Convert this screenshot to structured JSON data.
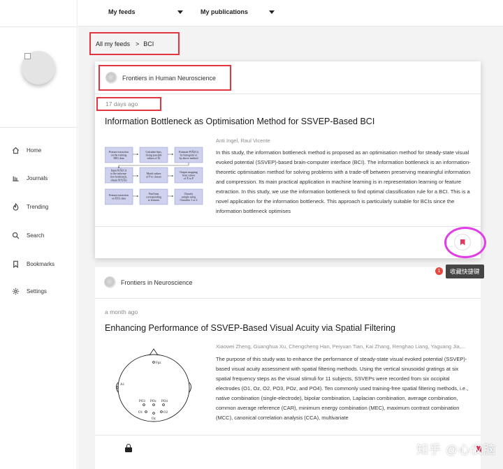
{
  "topbar": {
    "my_feeds": "My feeds",
    "my_publications": "My publications"
  },
  "breadcrumb": {
    "root": "All my feeds",
    "separator": ">",
    "current": "BCI"
  },
  "sidebar": {
    "items": [
      {
        "label": "Home",
        "icon": "home-icon"
      },
      {
        "label": "Journals",
        "icon": "journals-icon"
      },
      {
        "label": "Trending",
        "icon": "flame-icon"
      },
      {
        "label": "Search",
        "icon": "search-icon"
      },
      {
        "label": "Bookmarks",
        "icon": "bookmark-icon"
      },
      {
        "label": "Settings",
        "icon": "gear-icon"
      }
    ]
  },
  "articles": [
    {
      "source": "Frontiers in Human Neuroscience",
      "time": "17 days ago",
      "title": "Information Bottleneck as Optimisation Method for SSVEP-Based BCI",
      "authors": "Anti Ingel, Raul Vicente",
      "abstract": "In this study, the information bottleneck method is proposed as an optimisation method for steady-state visual evoked potential (SSVEP)-based brain-computer interface (BCI). The information bottleneck is an information-theoretic optimisation method for solving problems with a trade-off between preserving meaningful information and compression. Its main practical application in machine learning is in representation learning or feature extraction. In this study, we use the information bottleneck to find optimal classification rule for a BCI. This is a novel application for the information bottleneck. This approach is particularly suitable for BCIs since the information bottleneck optimises",
      "figure": {
        "boxes": [
          [
            "Feature extraction",
            "on the training",
            "EEG data"
          ],
          [
            "Calculate bins,",
            "fixing possible",
            "values of X̂i"
          ],
          [
            "Estimate P(X̂i|Ci)",
            "by histogram or",
            "by above method"
          ],
          [
            "Input P(X̂i|Ci)",
            "to the informa-",
            "tion bottleneck,",
            "obtain P(Y|X̂i)"
          ],
          [
            "Match values",
            "of P to classes"
          ],
          [
            "Output mapping",
            "from values",
            "of X̂ to P"
          ],
          [
            "Feature extraction",
            "on EEG data"
          ],
          [
            "Find bins",
            "corresponding",
            "to features"
          ],
          [
            "Classify",
            "sample using",
            "Classifier 1 or 2"
          ]
        ]
      }
    },
    {
      "source": "Frontiers in Neuroscience",
      "time": "a month ago",
      "title": "Enhancing Performance of SSVEP-Based Visual Acuity via Spatial Filtering",
      "authors": "Xiaowei Zheng, Guanghua Xu, Chengcheng Han, Peiyuan Tian, Kai Zhang, Renghao Liang, Yaguang Jia,...",
      "abstract": "The purpose of this study was to enhance the performance of steady-state visual evoked potential (SSVEP)-based visual acuity assessment with spatial filtering methods. Using the vertical sinusoidal gratings at six spatial frequency steps as the visual stimuli for 11 subjects, SSVEPs were recorded from six occipital electrodes (O1, Oz, O2, PO3, POz, and PO4). Ten commonly used training-free spatial filtering methods, i.e., native combination (single-electrode), bipolar combination, Laplacian combination, average combination, common average reference (CAR), minimum energy combination (MEC), maximum contrast combination (MCC), canonical correlation analysis (CCA), multivariate",
      "figure": {
        "labels": {
          "fpz": "Fpz",
          "a1": "A1",
          "po3": "PO3",
          "poz": "POz",
          "po4": "PO4",
          "o1": "O1",
          "oz": "Oz",
          "o2": "O2"
        }
      }
    }
  ],
  "tooltip": {
    "badge": "1",
    "text": "收藏快捷键"
  },
  "watermark": "知乎 @心仪脑",
  "colors": {
    "highlight_red": "#e3343f",
    "highlight_magenta": "#e23ce6",
    "bookmark_accent": "#e23a5e"
  }
}
